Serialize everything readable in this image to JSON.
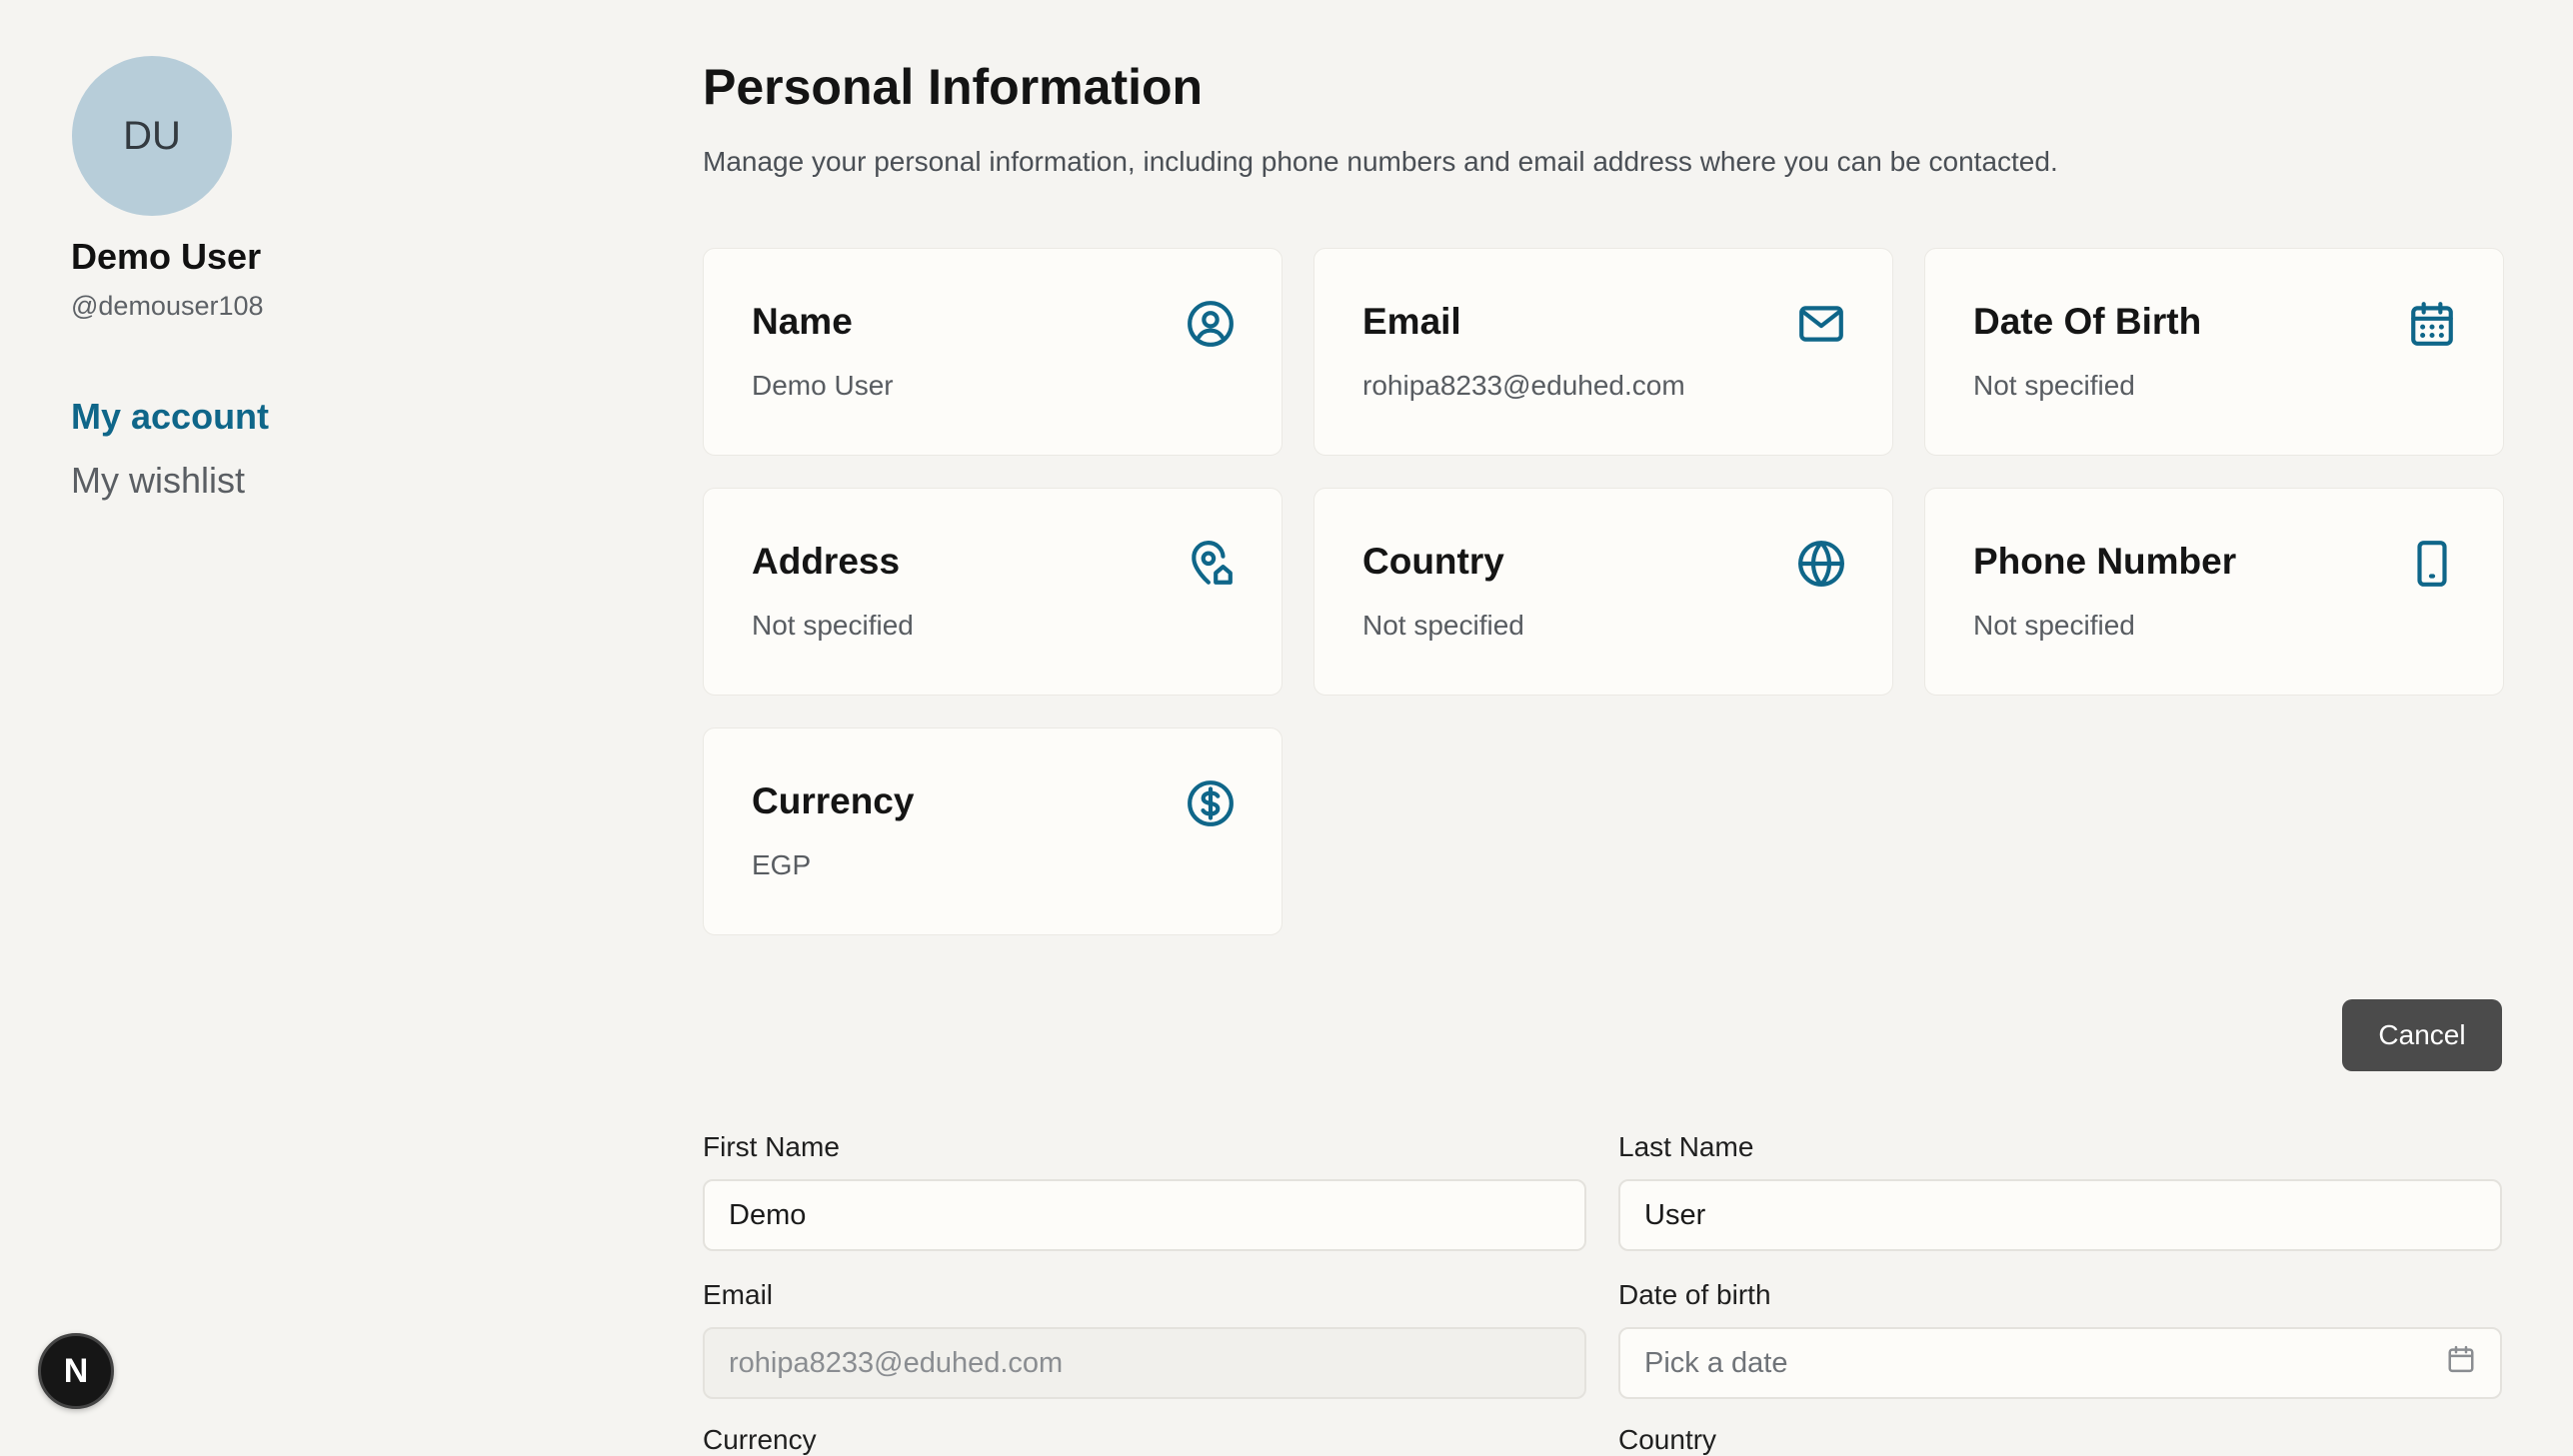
{
  "profile": {
    "initials": "DU",
    "name": "Demo User",
    "handle": "@demouser108"
  },
  "nav": {
    "account": "My account",
    "wishlist": "My wishlist"
  },
  "page": {
    "title": "Personal Information",
    "description": "Manage your personal information, including phone numbers and email address where you can be contacted."
  },
  "cards": [
    {
      "title": "Name",
      "value": "Demo User",
      "icon": "user-circle-icon"
    },
    {
      "title": "Email",
      "value": "rohipa8233@eduhed.com",
      "icon": "mail-icon"
    },
    {
      "title": "Date Of Birth",
      "value": "Not specified",
      "icon": "calendar-icon"
    },
    {
      "title": "Address",
      "value": "Not specified",
      "icon": "map-pin-home-icon"
    },
    {
      "title": "Country",
      "value": "Not specified",
      "icon": "globe-icon"
    },
    {
      "title": "Phone Number",
      "value": "Not specified",
      "icon": "smartphone-icon"
    },
    {
      "title": "Currency",
      "value": "EGP",
      "icon": "dollar-circle-icon"
    }
  ],
  "form": {
    "cancel_label": "Cancel",
    "first_name_label": "First Name",
    "first_name_value": "Demo",
    "last_name_label": "Last Name",
    "last_name_value": "User",
    "email_label": "Email",
    "email_value": "rohipa8233@eduhed.com",
    "dob_label": "Date of birth",
    "dob_placeholder": "Pick a date",
    "currency_label": "Currency",
    "country_label": "Country"
  },
  "badge": {
    "letter": "N"
  },
  "colors": {
    "accent": "#0f6689",
    "background": "#f5f4f1",
    "card": "#fdfcf9",
    "button": "#4b4b4b"
  }
}
